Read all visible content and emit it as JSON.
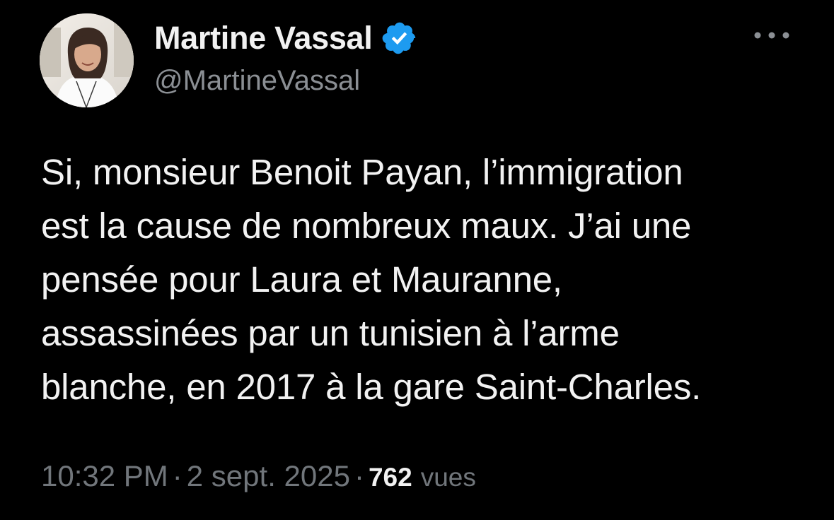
{
  "author": {
    "display_name": "Martine Vassal",
    "handle": "@MartineVassal",
    "verified_icon": "verified-badge-icon",
    "verified_color": "#1d9bf0"
  },
  "tweet": {
    "lines": [
      "Si, monsieur Benoit Payan, l’immigration",
      "est la cause de nombreux maux. J’ai une",
      "pensée pour Laura et Mauranne,",
      "assassinées par un tunisien à l’arme",
      "blanche, en 2017 à la gare Saint-Charles."
    ]
  },
  "meta": {
    "time": "10:32 PM",
    "separator": "·",
    "date": "2 sept. 2025",
    "views_count": "762",
    "views_label": "vues"
  },
  "colors": {
    "background": "#000000",
    "text": "#f2f2f2",
    "secondary_text": "#71767b"
  }
}
